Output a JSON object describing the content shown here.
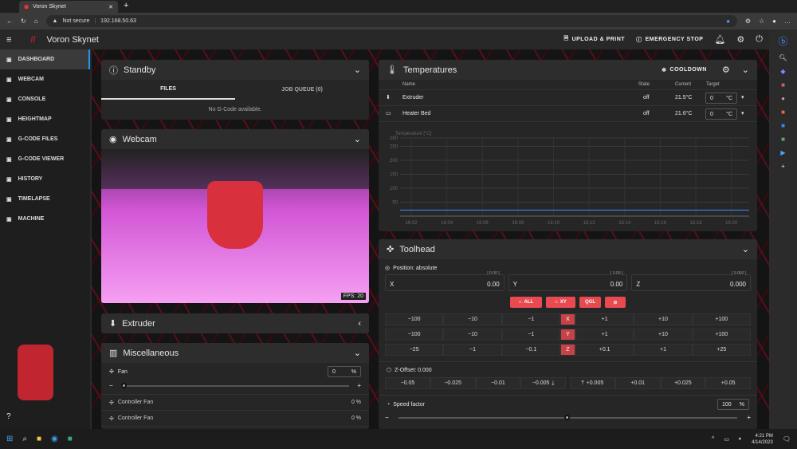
{
  "browser": {
    "tab_title": "Voron Skynet",
    "security": "Not secure",
    "url": "192.168.50.63"
  },
  "app": {
    "title": "Voron Skynet",
    "upload_label": "UPLOAD & PRINT",
    "estop_label": "EMERGENCY STOP"
  },
  "sidebar": {
    "items": [
      {
        "label": "DASHBOARD",
        "icon": "monitor-icon"
      },
      {
        "label": "WEBCAM",
        "icon": "webcam-icon"
      },
      {
        "label": "CONSOLE",
        "icon": "console-icon"
      },
      {
        "label": "HEIGHTMAP",
        "icon": "grid-icon"
      },
      {
        "label": "G-CODE FILES",
        "icon": "file-icon"
      },
      {
        "label": "G-CODE VIEWER",
        "icon": "3d-icon"
      },
      {
        "label": "HISTORY",
        "icon": "history-icon"
      },
      {
        "label": "TIMELAPSE",
        "icon": "timelapse-icon"
      },
      {
        "label": "MACHINE",
        "icon": "wrench-icon"
      }
    ]
  },
  "standby": {
    "title": "Standby",
    "tabs": [
      "FILES",
      "JOB QUEUE (0)"
    ],
    "empty": "No G-Code available."
  },
  "webcam": {
    "title": "Webcam",
    "fps": "FPS: 20"
  },
  "extruder": {
    "title": "Extruder"
  },
  "misc": {
    "title": "Miscellaneous",
    "fan_label": "Fan",
    "fan_value": "0",
    "fan_unit": "%",
    "fan_fraction": 0,
    "controller_fans": [
      {
        "label": "Controller Fan",
        "value": "0 %"
      },
      {
        "label": "Controller Fan",
        "value": "0 %"
      }
    ]
  },
  "temperatures": {
    "title": "Temperatures",
    "cooldown": "COOLDOWN",
    "headers": [
      "Name",
      "State",
      "Current",
      "Target"
    ],
    "rows": [
      {
        "name": "Extruder",
        "state": "off",
        "current": "21.5°C",
        "target": "0",
        "unit": "°C"
      },
      {
        "name": "Heater Bed",
        "state": "off",
        "current": "21.6°C",
        "target": "0",
        "unit": "°C"
      }
    ]
  },
  "chart_data": {
    "type": "line",
    "ylabel": "Temperature [°C]",
    "ylim": [
      0,
      280
    ],
    "yticks": [
      50,
      100,
      150,
      200,
      250,
      280
    ],
    "xticks": [
      "16:02",
      "16:04",
      "16:06",
      "16:08",
      "16:10",
      "16:12",
      "16:14",
      "16:16",
      "16:18",
      "16:20"
    ],
    "series": [
      {
        "name": "Extruder",
        "color": "#2f7fd8",
        "values": [
          21.5,
          21.5,
          21.5,
          21.5,
          21.5,
          21.5,
          21.5,
          21.5,
          21.5,
          21.5,
          21.5
        ]
      }
    ]
  },
  "toolhead": {
    "title": "Toolhead",
    "position_mode": "Position: absolute",
    "axes": [
      {
        "label": "X",
        "value": "0.00",
        "raw": "[ 0.00 ]"
      },
      {
        "label": "Y",
        "value": "0.00",
        "raw": "[ 0.00 ]"
      },
      {
        "label": "Z",
        "value": "0.000",
        "raw": "[ 0.000 ]"
      }
    ],
    "home_buttons": [
      "ALL",
      "XY",
      "QGL"
    ],
    "jog": [
      {
        "axis": "X",
        "neg": [
          "−100",
          "−10",
          "−1"
        ],
        "pos": [
          "+1",
          "+10",
          "+100"
        ]
      },
      {
        "axis": "Y",
        "neg": [
          "−100",
          "−10",
          "−1"
        ],
        "pos": [
          "+1",
          "+10",
          "+100"
        ]
      },
      {
        "axis": "Z",
        "neg": [
          "−25",
          "−1",
          "−0.1"
        ],
        "pos": [
          "+0.1",
          "+1",
          "+25"
        ]
      }
    ],
    "zoffset_label": "Z-Offset: 0.000",
    "zoffset_neg": [
      "−0.05",
      "−0.025",
      "−0.01",
      "−0.005"
    ],
    "zoffset_pos": [
      "+0.005",
      "+0.01",
      "+0.025",
      "+0.05"
    ],
    "speed_label": "Speed factor",
    "speed_value": "100",
    "speed_unit": "%",
    "speed_fraction": 0.49
  },
  "taskbar": {
    "time": "4:21 PM",
    "date": "4/14/2023"
  }
}
